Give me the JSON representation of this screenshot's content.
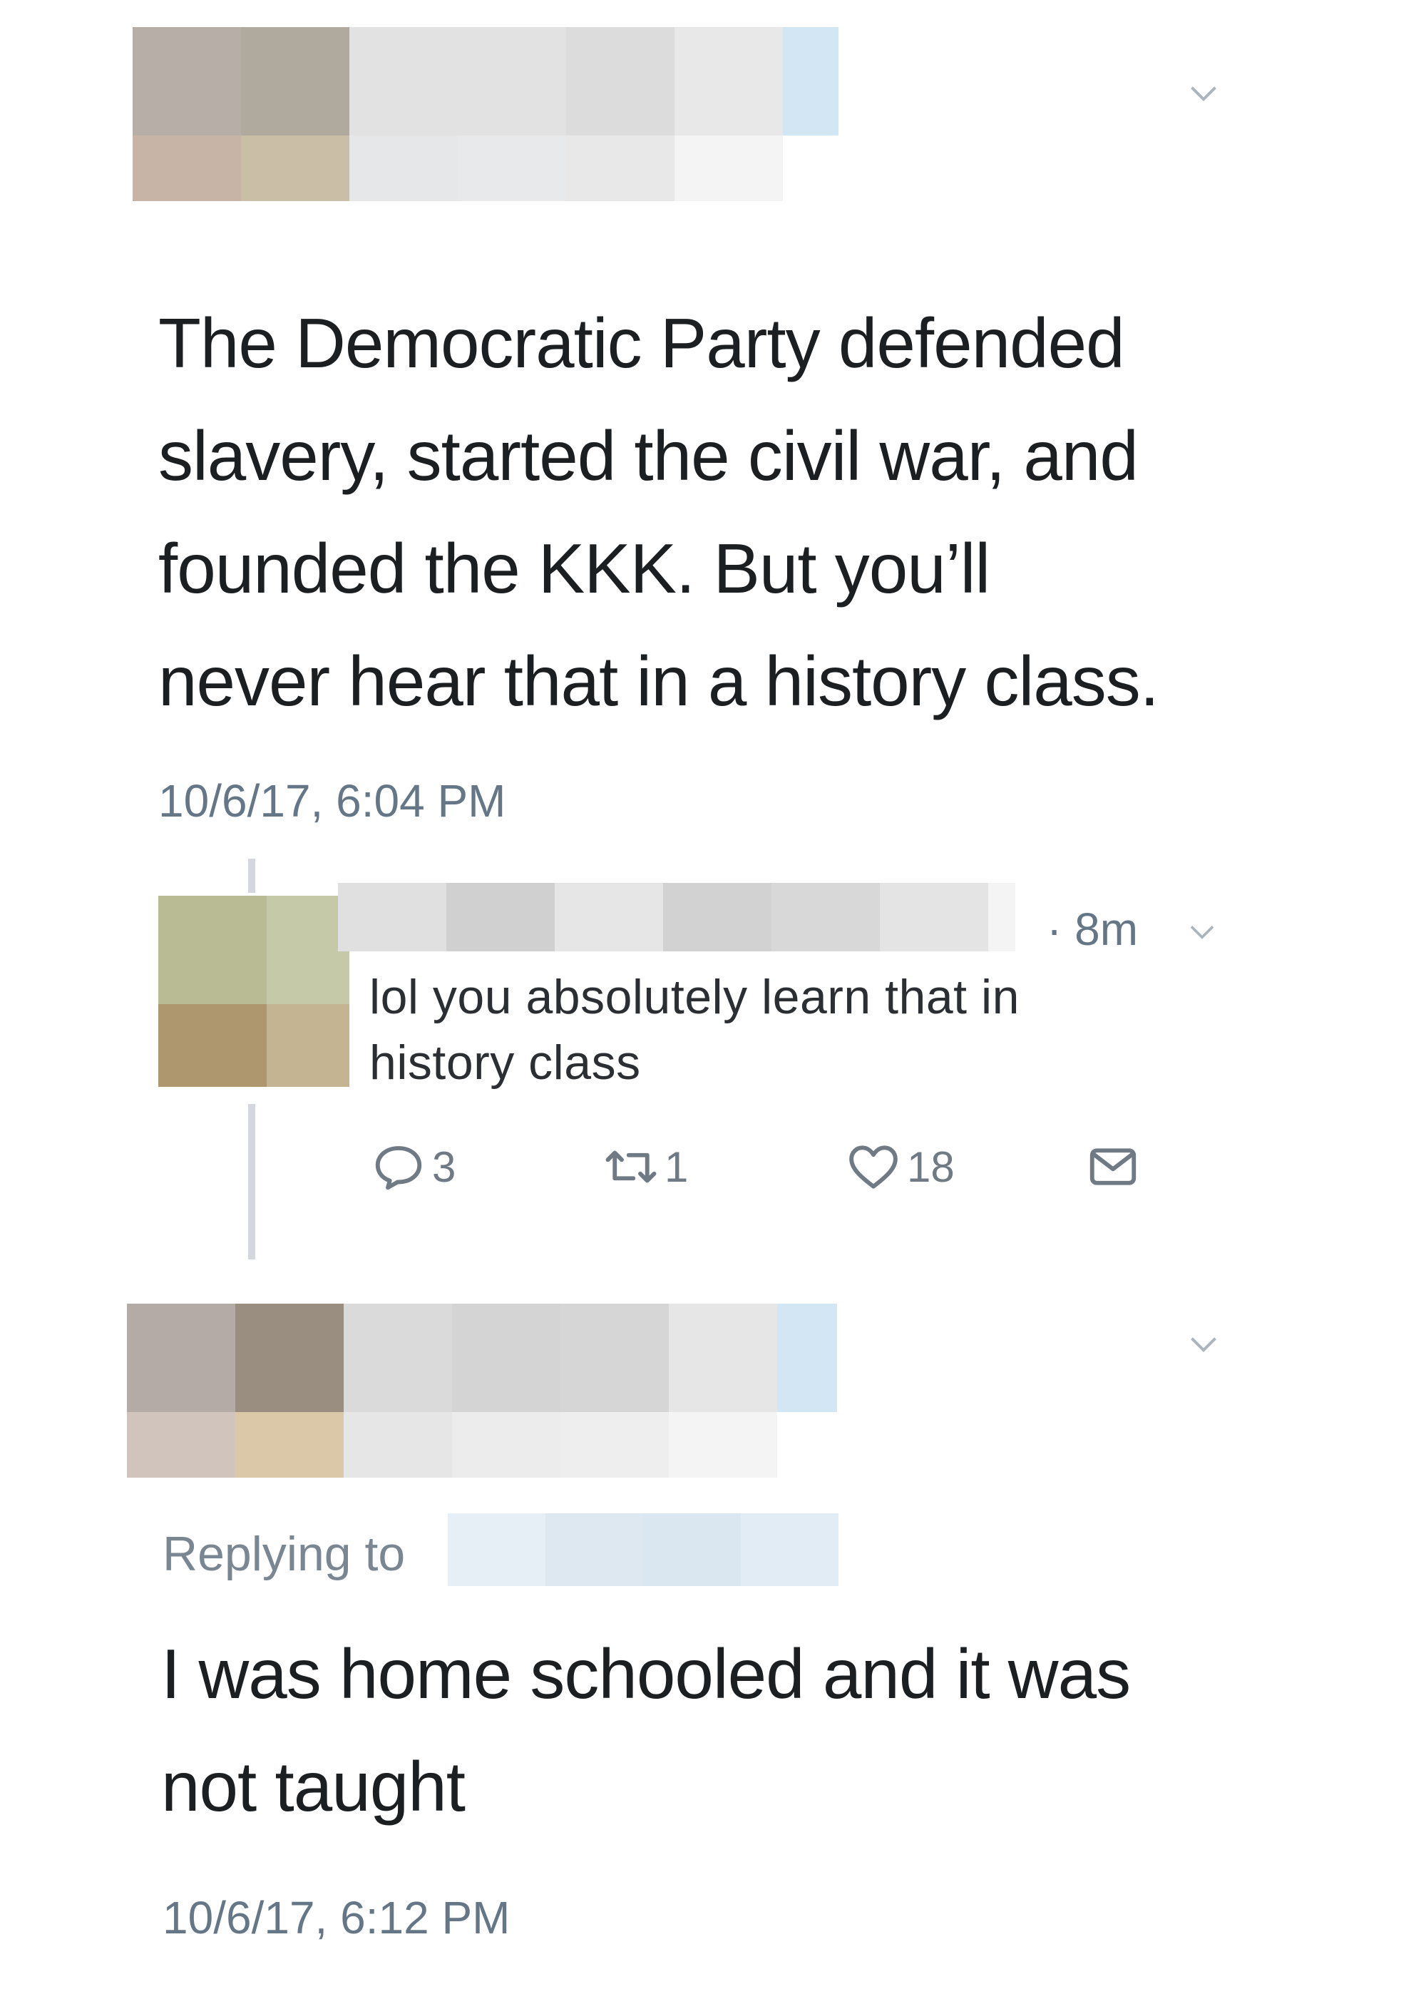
{
  "tweet1": {
    "text_lines": [
      "The Democratic Party defended",
      "slavery, started the civil war, and",
      "founded the KKK. But you’ll",
      "never hear that in a history class."
    ],
    "timestamp": "10/6/17, 6:04 PM",
    "menu_icon": "chevron-down-icon"
  },
  "reply": {
    "time": "· 8m",
    "text_lines": [
      "lol you absolutely learn that in",
      "history class"
    ],
    "actions": {
      "replies": "3",
      "retweets": "1",
      "likes": "18"
    },
    "icons": [
      "reply-icon",
      "retweet-icon",
      "heart-icon",
      "mail-icon"
    ]
  },
  "tweet2": {
    "replying_label": "Replying to",
    "text_lines": [
      "I was home schooled and it was",
      "not taught"
    ],
    "timestamp": "10/6/17, 6:12 PM",
    "menu_icon": "chevron-down-icon"
  },
  "colors": {
    "text": "#14171a",
    "secondary": "#657786",
    "thread_line": "#d4d8dc",
    "link_blur": "#d6e8f6"
  }
}
